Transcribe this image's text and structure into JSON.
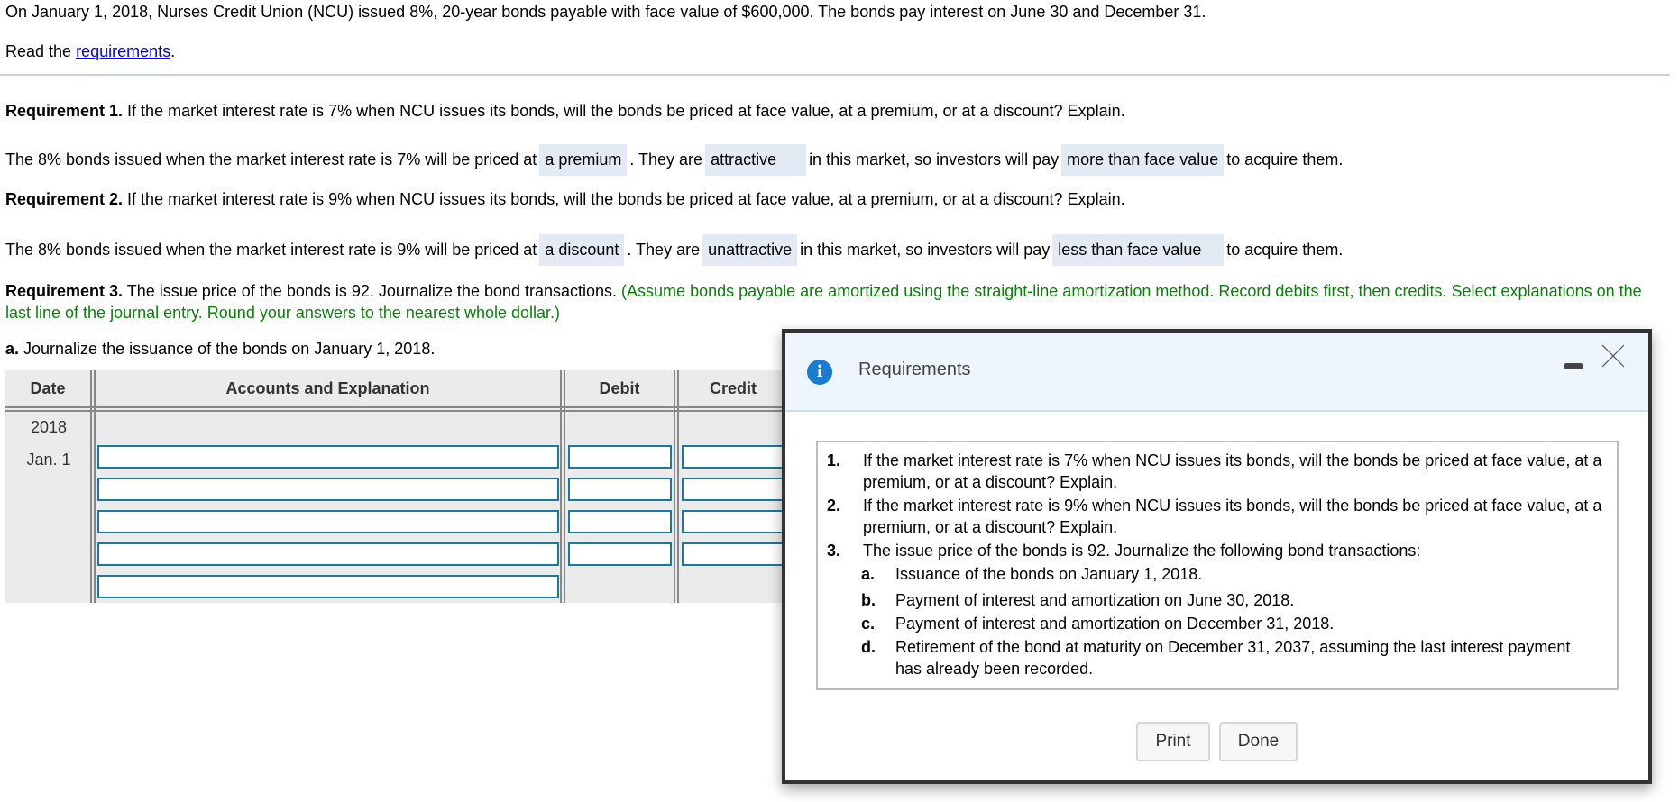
{
  "intro": "On January 1, 2018, Nurses Credit Union (NCU) issued 8%, 20-year bonds payable with face value of $600,000. The bonds pay interest on June 30 and December 31.",
  "read": {
    "prefix": "Read the ",
    "link": "requirements",
    "suffix": "."
  },
  "req1": {
    "label": "Requirement 1.",
    "question": " If the market interest rate is 7% when NCU issues its bonds, will the bonds be priced at face value, at a premium, or at a discount? Explain.",
    "s1": "The 8% bonds issued when the market interest rate is 7% will be priced at",
    "a1": "a premium",
    "s2": ". They are",
    "a2": "attractive",
    "s3": "in this market, so investors will pay",
    "a3": "more than face value",
    "s4": "to acquire them."
  },
  "req2": {
    "label": "Requirement 2.",
    "question": " If the market interest rate is 9% when NCU issues its bonds, will the bonds be priced at face value, at a premium, or at a discount? Explain.",
    "s1": "The 8% bonds issued when the market interest rate is 9% will be priced at",
    "a1": "a discount",
    "s2": ". They are",
    "a2": "unattractive",
    "s3": "in this market, so investors will pay",
    "a3": "less than face value",
    "s4": "to acquire them."
  },
  "req3": {
    "label": "Requirement 3.",
    "text": " The issue price of the bonds is 92. Journalize the bond transactions. ",
    "instructions": "(Assume bonds payable are amortized using the straight-line amortization method. Record debits first, then credits. Select explanations on the last line of the journal entry. Round your answers to the nearest whole dollar.)"
  },
  "part_a": {
    "label": "a.",
    "text": " Journalize the issuance of the bonds on January 1, 2018."
  },
  "journal": {
    "headers": {
      "date": "Date",
      "accounts": "Accounts and Explanation",
      "debit": "Debit",
      "credit": "Credit"
    },
    "year": "2018",
    "date": "Jan. 1",
    "rows": [
      {
        "account": "",
        "debit": "",
        "credit": ""
      },
      {
        "account": "",
        "debit": "",
        "credit": ""
      },
      {
        "account": "",
        "debit": "",
        "credit": ""
      },
      {
        "account": "",
        "debit": "",
        "credit": ""
      },
      {
        "account": ""
      }
    ]
  },
  "modal": {
    "title": "Requirements",
    "items": [
      {
        "num": "1.",
        "text": "If the market interest rate is 7% when NCU issues its bonds, will the bonds be priced at face value, at a premium, or at a discount? Explain."
      },
      {
        "num": "2.",
        "text": "If the market interest rate is 9% when NCU issues its bonds, will the bonds be priced at face value, at a premium, or at a discount? Explain."
      },
      {
        "num": "3.",
        "text": "The issue price of the bonds is 92. Journalize the following bond transactions:"
      }
    ],
    "subitems": [
      {
        "num": "a.",
        "text": "Issuance of the bonds on January 1, 2018."
      },
      {
        "num": "b.",
        "text": "Payment of interest and amortization on June 30, 2018."
      },
      {
        "num": "c.",
        "text": "Payment of interest and amortization on December 31, 2018."
      },
      {
        "num": "d.",
        "text": "Retirement of the bond at maturity on December 31, 2037, assuming the last interest payment has already been recorded."
      }
    ],
    "print_label": "Print",
    "done_label": "Done"
  },
  "colors": {
    "link": "#0000ee",
    "instruction_green": "#0a7f0a",
    "answer_bg": "#e4eaf4",
    "input_border": "#1a7a9c",
    "info_icon": "#1a7bcf"
  }
}
